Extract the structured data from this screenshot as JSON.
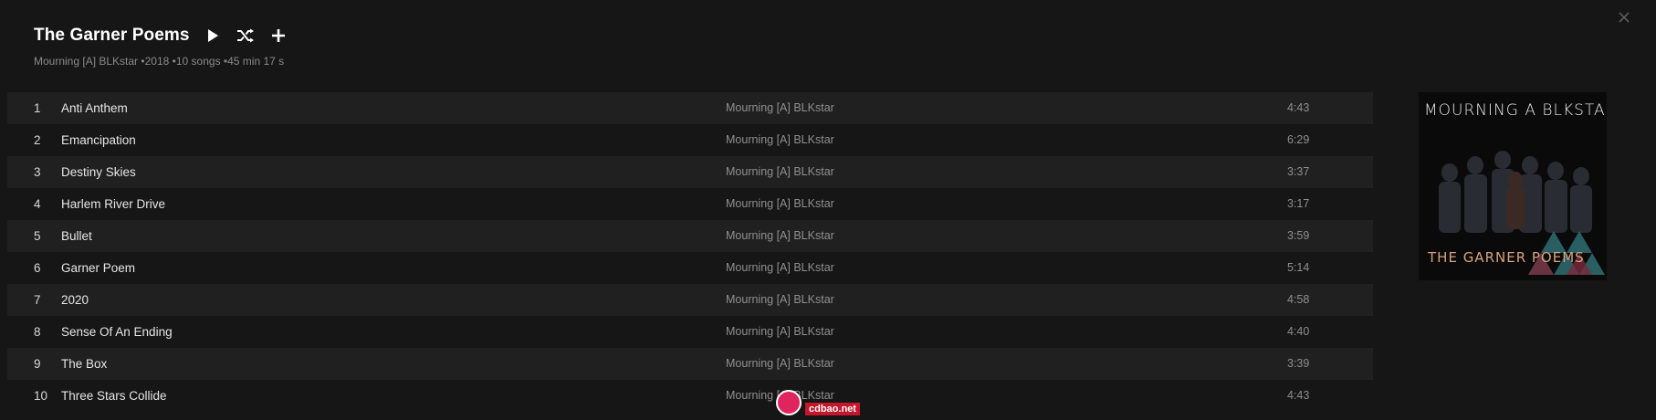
{
  "album": {
    "title": "The Garner Poems",
    "artist": "Mourning [A] BLKstar",
    "year": "2018",
    "song_count": "10 songs",
    "duration": "45 min 17 s"
  },
  "actions": {
    "play_icon": "play-icon",
    "shuffle_icon": "shuffle-icon",
    "add_icon": "plus-icon",
    "close_icon": "close-icon"
  },
  "tracks": [
    {
      "number": "1",
      "title": "Anti Anthem",
      "artist": "Mourning [A] BLKstar",
      "duration": "4:43"
    },
    {
      "number": "2",
      "title": "Emancipation",
      "artist": "Mourning [A] BLKstar",
      "duration": "6:29"
    },
    {
      "number": "3",
      "title": "Destiny Skies",
      "artist": "Mourning [A] BLKstar",
      "duration": "3:37"
    },
    {
      "number": "4",
      "title": "Harlem River Drive",
      "artist": "Mourning [A] BLKstar",
      "duration": "3:17"
    },
    {
      "number": "5",
      "title": "Bullet",
      "artist": "Mourning [A] BLKstar",
      "duration": "3:59"
    },
    {
      "number": "6",
      "title": "Garner Poem",
      "artist": "Mourning [A] BLKstar",
      "duration": "5:14"
    },
    {
      "number": "7",
      "title": "2020",
      "artist": "Mourning [A] BLKstar",
      "duration": "4:58"
    },
    {
      "number": "8",
      "title": "Sense Of An Ending",
      "artist": "Mourning [A] BLKstar",
      "duration": "4:40"
    },
    {
      "number": "9",
      "title": "The Box",
      "artist": "Mourning [A] BLKstar",
      "duration": "3:39"
    },
    {
      "number": "10",
      "title": "Three Stars Collide",
      "artist": "Mourning [A] BLKstar",
      "duration": "4:43"
    }
  ],
  "cover": {
    "top_text": "MOURNING A BLKSTAR",
    "bottom_text": "THE GARNER POEMS"
  },
  "watermark": {
    "text": "cdbao.net"
  },
  "colors": {
    "background": "#161616",
    "row_alt": "#202020",
    "text_primary": "#ffffff",
    "text_secondary": "#8f8f8f"
  }
}
